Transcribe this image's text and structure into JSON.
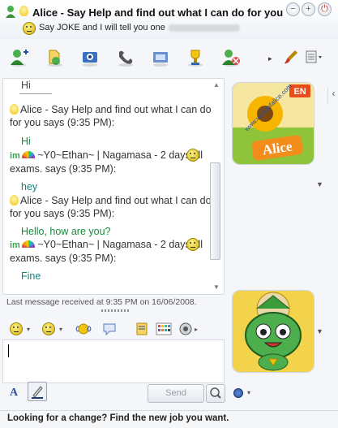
{
  "window": {
    "title": "Alice - Say Help and find out what I can do for you",
    "subtitle": "Say JOKE and I will tell you one"
  },
  "conversation": {
    "partial_top": "Hi",
    "messages": [
      {
        "sender": "Alice - Say Help and find out what I can do for you says (9:35 PM):",
        "text": "Hi"
      },
      {
        "sender": "~Y0~Ethan~ | Nagamasa - 2 days till exams. says (9:35 PM):",
        "text": "hey"
      },
      {
        "sender": "Alice - Say Help and find out what I can do for you says (9:35 PM):",
        "text": "Hello, how are you?"
      },
      {
        "sender": "~Y0~Ethan~ | Nagamasa - 2 days till exams. says (9:35 PM):",
        "text": "Fine"
      }
    ],
    "im_logo": "im"
  },
  "avatar_top": {
    "badge": "EN",
    "watermark": "www.worldofalice.com",
    "name": "Alice"
  },
  "status": {
    "last_message": "Last message received at 9:35 PM on 16/06/2008."
  },
  "input": {
    "value": ""
  },
  "controls": {
    "font_label": "A",
    "send_label": "Send"
  },
  "footer": {
    "ad": "Looking for a change? Find the new job you want."
  },
  "colors": {
    "accent": "#2a4ea0",
    "link_green": "#168a3a",
    "teal_text": "#1a7f7f"
  }
}
